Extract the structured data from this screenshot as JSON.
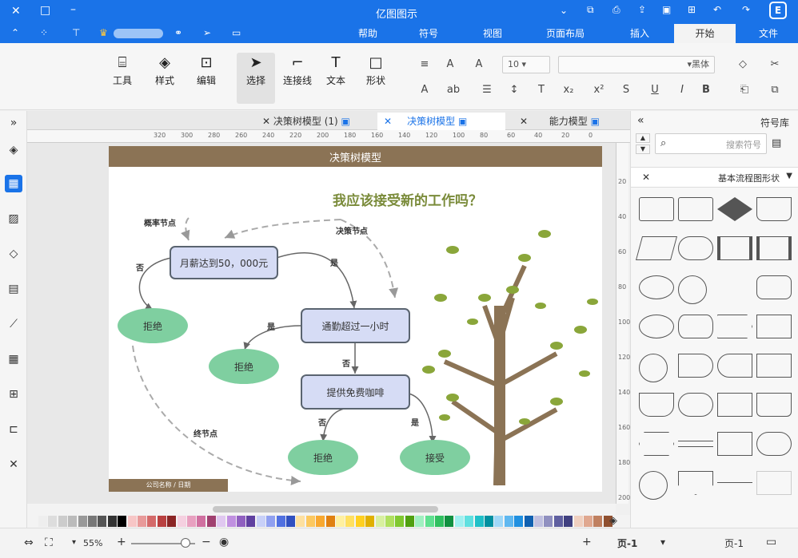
{
  "app": {
    "title": "亿图图示"
  },
  "titlebar_icons": [
    "minimize-icon",
    "maximize-icon",
    "close-icon",
    "chevron-down-icon",
    "share-icon",
    "print-icon",
    "export-icon",
    "image-icon",
    "add-icon",
    "undo-icon",
    "redo-icon",
    "logo-icon"
  ],
  "menu": {
    "tabs": [
      "文件",
      "开始",
      "插入",
      "页面布局",
      "视图",
      "符号",
      "帮助"
    ],
    "active": "开始"
  },
  "ribbon": {
    "tools": [
      "工具",
      "样式",
      "编辑",
      "选择",
      "连接线",
      "文本",
      "形状"
    ],
    "font_name": "黑体",
    "font_size": "10",
    "format_icons": [
      "B",
      "I",
      "U",
      "S",
      "x²",
      "x₂",
      "ab"
    ]
  },
  "tabs": [
    "能力模型",
    "决策树模型",
    "决策树模型 (1)"
  ],
  "ruler": {
    "h_labels": [
      "0",
      "20",
      "40",
      "60",
      "80",
      "100",
      "120",
      "140",
      "160",
      "180",
      "200",
      "220",
      "240",
      "260",
      "280",
      "300",
      "320"
    ],
    "v_labels": [
      "20",
      "40",
      "60",
      "80",
      "100",
      "120",
      "140",
      "160",
      "180",
      "200"
    ]
  },
  "diagram": {
    "header": "决策树模型",
    "question": "我应该接受新的工作吗？",
    "nodes": {
      "salary": "月薪达到50，000元",
      "commute": "通勤超过一小时",
      "coffee": "提供免费咖啡",
      "reject1": "拒绝",
      "reject2": "拒绝",
      "reject3": "拒绝",
      "accept": "接受"
    },
    "edge_labels": {
      "yes1": "是",
      "no1": "否",
      "yes2": "是",
      "no2": "否",
      "yes3": "是",
      "no3": "否"
    },
    "annotations": {
      "decision": "决策节点",
      "chance": "概率节点",
      "end": "终节点"
    },
    "footer": "公司名称 / 日期"
  },
  "rightpanel": {
    "title": "符号库",
    "search_placeholder": "搜索符号",
    "section": "基本流程图形状"
  },
  "status": {
    "zoom": "55%",
    "page_label": "页-1",
    "page_tab": "页-1"
  },
  "colors": {
    "accent": "#1a73e8",
    "header_bar": "#8b7355",
    "node_fill": "#d6dcf5",
    "node_border": "#5a6470",
    "ellipse": "#7fcfa0",
    "title_green": "#7a8b3a",
    "trunk": "#8b7355",
    "leaf": "#8aa63a"
  }
}
